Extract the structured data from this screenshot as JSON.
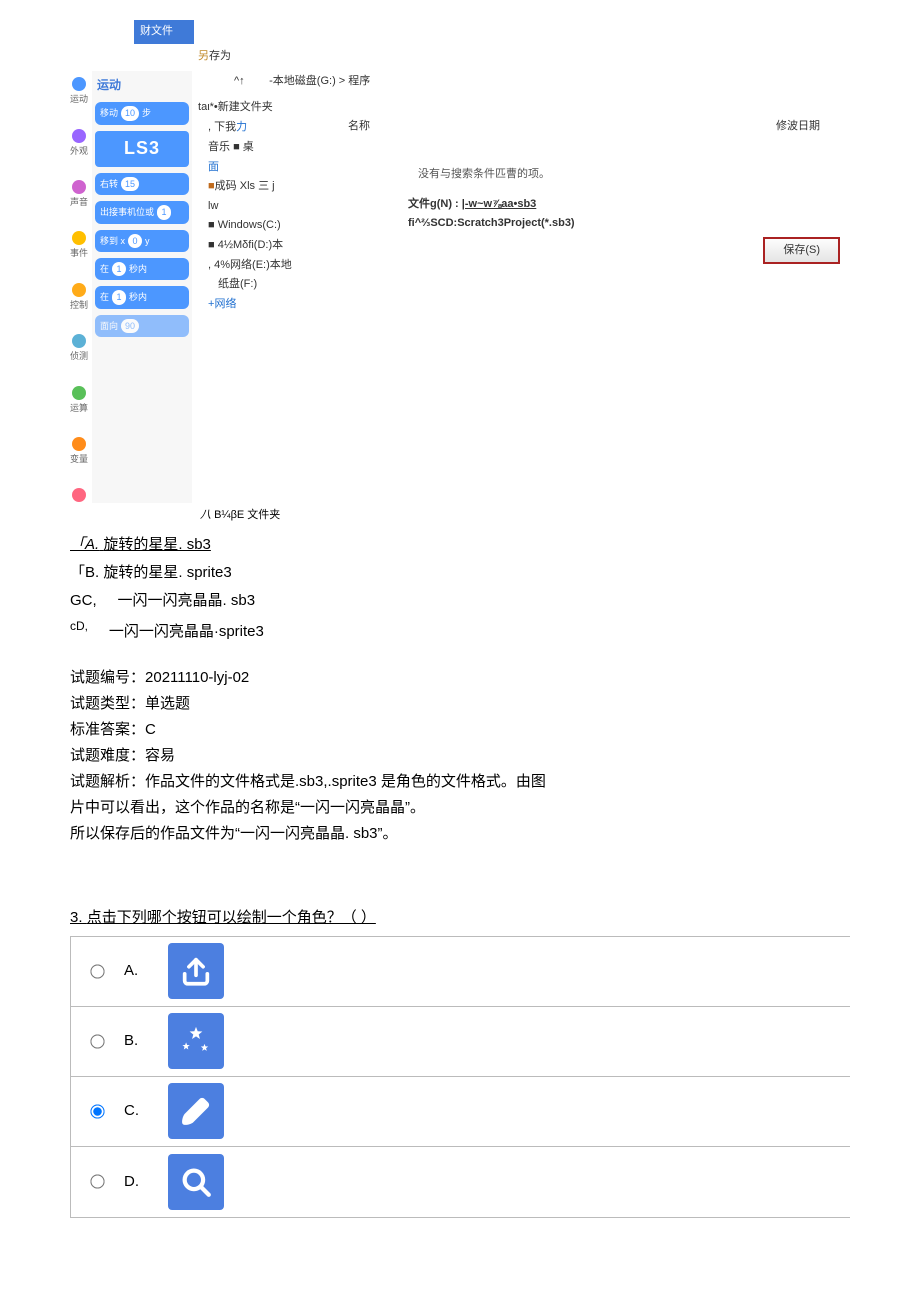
{
  "topbar_label": "财文件",
  "saveas_label": "存为",
  "saveas_prefix": "另",
  "dialog": {
    "path_arrow": "^↑",
    "path": "-本地磁盘(G:) > 程序",
    "new_folder": "taι*•新建文件夹",
    "col_name": "名称",
    "col_date": "修波日期",
    "no_result": "没有与搜索条件匹曹的项。",
    "side": {
      "download": "下我",
      "music_desk": "音乐 ■ 桌",
      "mian": "面",
      "code_xls": "成码 Xls 三 j",
      "lw": "lw",
      "win": "Windows(C:)",
      "d": "4½Mδfi(D:)本",
      "e": "4%网络(E:)本地",
      "f": "纸盘(F:)",
      "net": "+网络"
    },
    "download_link_word": "力",
    "fn_label": "文件g(N) :",
    "fn_value": "|-w~w⅞aa•sb3",
    "fi_label": "fi^⅔SCD:Scratch3Project(*.sb3)",
    "hide_folder": "B¼βE 文件夹",
    "hide_folder_prefix": "八",
    "save_btn": "保存(S)"
  },
  "palette": {
    "header": "运动",
    "cats": [
      {
        "label": "运动",
        "color": "#4c97ff"
      },
      {
        "label": "外观",
        "color": "#9966ff"
      },
      {
        "label": "声音",
        "color": "#cf63cf"
      },
      {
        "label": "事件",
        "color": "#ffbf00"
      },
      {
        "label": "控制",
        "color": "#ffab19"
      },
      {
        "label": "侦测",
        "color": "#5cb1d6"
      },
      {
        "label": "运算",
        "color": "#59c059"
      },
      {
        "label": "变量",
        "color": "#ff8c1a"
      },
      {
        "label": "",
        "color": "#ff6680"
      }
    ],
    "ls3": "LS3",
    "blocks": [
      {
        "t": "移动",
        "v": "10",
        "suf": "步"
      },
      {
        "t": "右转",
        "v": "15",
        "suf": ""
      },
      {
        "t": "出接事机位或",
        "v": "1",
        "suf": ""
      },
      {
        "t": "移到 x",
        "v": "0",
        "suf": "y"
      },
      {
        "t": "在",
        "v": "1",
        "suf": "秒内"
      },
      {
        "t": "在",
        "v": "1",
        "suf": "秒内"
      },
      {
        "t": "面向",
        "v": "90",
        "suf": ""
      }
    ]
  },
  "options": {
    "a_pref": "「A.",
    "a": "旋转的星星. sb3",
    "b_pref": "「B.",
    "b": "旋转的星星. sprite3",
    "c_pref": "GC,",
    "c": "一闪一闪亮晶晶. sb3",
    "d_pref": "cD,",
    "d": "一闪一闪亮晶晶·sprite3"
  },
  "meta": {
    "id_l": "试题编号：",
    "id": "20211110-lyj-02",
    "type_l": "试题类型：",
    "type": "单选题",
    "ans_l": "标准答案：",
    "ans": "C",
    "diff_l": "试题难度：",
    "diff": "容易",
    "exp_l": "试题解析：",
    "exp1": "作品文件的文件格式是.sb3,.sprite3 是角色的文件格式。由图",
    "exp2": "片中可以看出，这个作品的名称是“一闪一闪亮晶晶”。",
    "exp3": "所以保存后的作品文件为“一闪一闪亮晶晶. sb3”。"
  },
  "q3": {
    "num": "3.",
    "text": "点击下列哪个按钮可以绘制一个角色？（ ）",
    "opts": [
      "A.",
      "B.",
      "C.",
      "D."
    ]
  }
}
